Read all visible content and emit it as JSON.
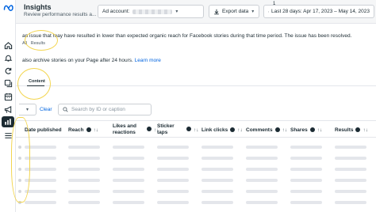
{
  "header": {
    "title": "Insights",
    "subtitle": "Review performance results a...",
    "ad_account_label": "Ad account:",
    "export_label": "Export data",
    "badge": "1",
    "date_range_label": "Last 28 days: Apr 17, 2023 – May 14, 2023"
  },
  "sidebar": {
    "icons": [
      "meta-logo",
      "home-icon",
      "bell-icon",
      "refresh-icon",
      "content-icon",
      "calendar-icon",
      "megaphone-icon",
      "insights-icon",
      "menu-icon"
    ],
    "active": "insights-icon"
  },
  "notices": {
    "issue_text": "an issue that may have resulted in lower than expected organic reach for Facebook stories during that time period. The issue has been resolved.",
    "mini_tabs": [
      "All",
      "Results"
    ],
    "archive_text": "also archive stories on your Page after 24 hours.",
    "learn_more": "Learn more"
  },
  "tabs": {
    "content_label": "Content"
  },
  "filters": {
    "clear_label": "Clear",
    "search_placeholder": "Search by ID or caption"
  },
  "table": {
    "columns": [
      {
        "label": "Date published",
        "sort": "↑↓"
      },
      {
        "label": "Reach",
        "sort": "↑↓"
      },
      {
        "label": "Likes and reactions",
        "sort": "↑↓"
      },
      {
        "label": "Sticker taps",
        "sort": "↑↓"
      },
      {
        "label": "Link clicks",
        "sort": "↑↓"
      },
      {
        "label": "Comments",
        "sort": "↑↓"
      },
      {
        "label": "Shares",
        "sort": "↑↓"
      },
      {
        "label": "Results",
        "sort": "↑↓"
      }
    ],
    "loading_rows": 6
  },
  "colors": {
    "accent": "#0064e0",
    "dark": "#1c2b33",
    "highlight": "#f2d03b"
  }
}
